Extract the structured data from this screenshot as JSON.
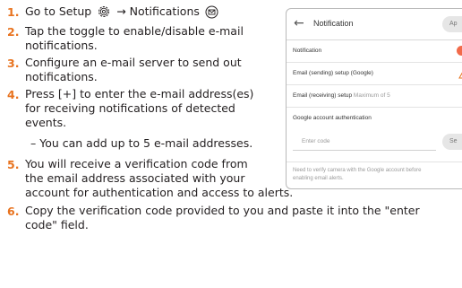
{
  "instructions": {
    "step1": {
      "number": "1.",
      "text_before": "Go to Setup",
      "arrow": "→",
      "text_after": "Notifications",
      "setup_icon": "gear-icon",
      "notification_icon": "envelope-icon"
    },
    "step2": {
      "number": "2.",
      "lines": [
        "Tap the toggle to enable/disable e-mail",
        "notifications."
      ]
    },
    "step3": {
      "number": "3.",
      "lines": [
        "Configure an e-mail server to send out",
        "notifications."
      ]
    },
    "step4": {
      "number": "4.",
      "lines": [
        "Press [+] to enter the e-mail address(es)",
        "for receiving notifications of detected",
        "events."
      ],
      "sub_note": "– You can add up to 5 e-mail addresses."
    },
    "step5": {
      "number": "5.",
      "lines": [
        "You will receive a verification code from",
        "the email address associated with your",
        "account for authentication and access to alerts."
      ]
    },
    "step6": {
      "number": "6.",
      "lines": [
        "Copy the verification code provided to you and paste it into the \"enter",
        "code\" field."
      ]
    }
  },
  "phone_screen": {
    "title": "Notification",
    "back_icon": "back-arrow-icon",
    "apply_label": "Ap",
    "rows": {
      "notification": "Notification",
      "email_sending": "Email (sending) setup (Google)",
      "email_receiving": "Email (receiving) setup",
      "email_receiving_hint": "Maximum of 5",
      "google_auth": "Google account authentication"
    },
    "notification_toggle_on": true,
    "toggle_color": "#f26a4a",
    "warning_icon": "warning-icon",
    "code_placeholder": "Enter code",
    "send_label": "Se",
    "note_lines": [
      "Need to verify camera with the Google account before",
      "enabling email alerts."
    ]
  },
  "colors": {
    "step_number": "#e8731f",
    "text": "#231f20"
  }
}
